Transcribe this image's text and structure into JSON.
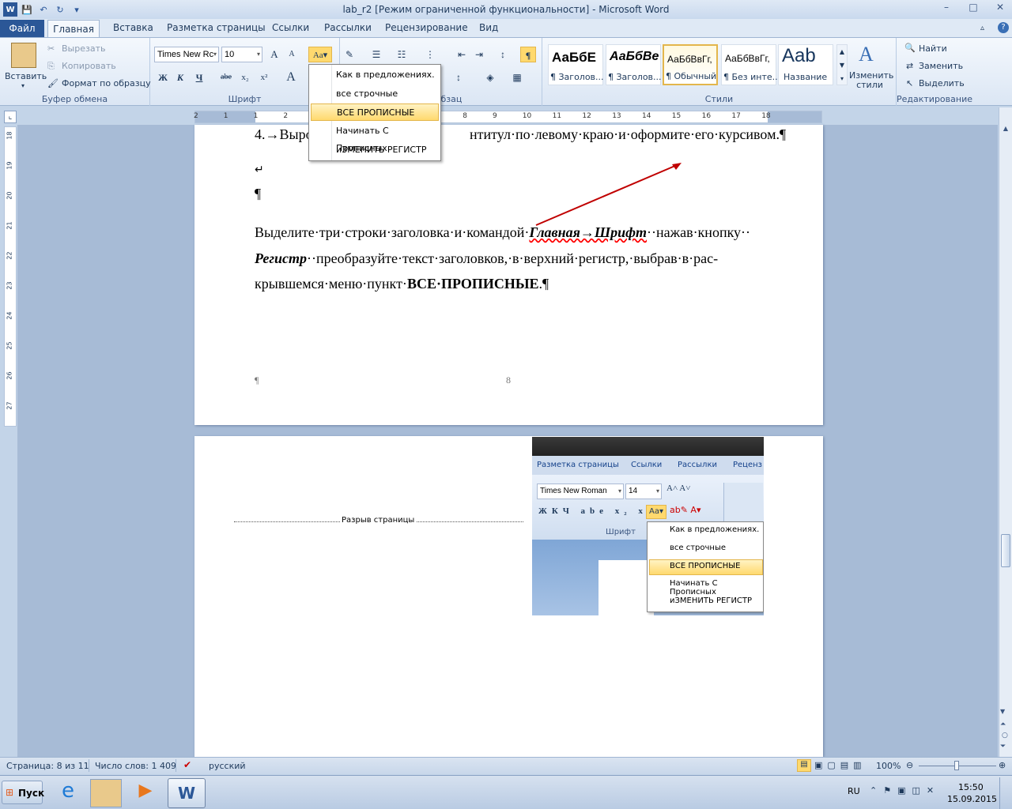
{
  "titlebar": {
    "title": "lab_r2 [Режим ограниченной функциональности]  -  Microsoft Word",
    "qat_icons": [
      "word-icon",
      "save-icon",
      "undo-icon",
      "redo-icon",
      "customize-icon"
    ],
    "min": "–",
    "max": "□",
    "close": "✕"
  },
  "tabs": {
    "file": "Файл",
    "home": "Главная",
    "items": [
      "Вставка",
      "Разметка страницы",
      "Ссылки",
      "Рассылки",
      "Рецензирование",
      "Вид"
    ]
  },
  "ribbon": {
    "clipboard": {
      "paste": "Вставить",
      "cut": "Вырезать",
      "copy": "Копировать",
      "format_painter": "Формат по образцу",
      "label": "Буфер обмена"
    },
    "font": {
      "name": "Times New Rc",
      "size": "10",
      "bold": "Ж",
      "italic": "К",
      "underline": "Ч",
      "strike": "abe",
      "sub": "x₂",
      "sup": "x²",
      "grow": "A",
      "shrink": "A",
      "case": "Aa",
      "label": "Шрифт"
    },
    "paragraph": {
      "label": "Абзац",
      "pilcrow": "¶"
    },
    "styles": {
      "label": "Стили",
      "items": [
        {
          "preview": "АаБбЕ",
          "name": "¶ Заголов..."
        },
        {
          "preview": "АаБбВе",
          "name": "¶ Заголов..."
        },
        {
          "preview": "АаБбВвГг,",
          "name": "¶ Обычный"
        },
        {
          "preview": "АаБбВвГг,",
          "name": "¶ Без инте..."
        },
        {
          "preview": "Aab",
          "name": "Название"
        }
      ],
      "change": "Изменить стили"
    },
    "editing": {
      "find": "Найти",
      "replace": "Заменить",
      "select": "Выделить",
      "label": "Редактирование"
    }
  },
  "case_menu": {
    "items": [
      "Как в предложениях.",
      "все строчные",
      "ВСЕ ПРОПИСНЫЕ",
      "Начинать С Прописных",
      "иЗМЕНИТЬ РЕГИСТР"
    ],
    "selected": 2
  },
  "ruler": {
    "h_ticks": [
      "2",
      "1",
      "1",
      "2",
      "3",
      "4",
      "5",
      "6",
      "7",
      "8",
      "9",
      "10",
      "11",
      "12",
      "13",
      "14",
      "15",
      "16",
      "17",
      "18"
    ],
    "v_ticks": [
      "18",
      "19",
      "20",
      "21",
      "22",
      "23",
      "24",
      "25",
      "26",
      "27"
    ]
  },
  "document": {
    "line1": "4.→Выро",
    "line1b": "нтитул·по·левому·краю·и·оформите·его·курсивом.¶",
    "linebreak": "↵",
    "pilcrow": "¶",
    "p1_a": "Выделите·три·строки·заголовка·и·командой·",
    "p1_b": "Главная→Шрифт",
    "p1_c": "··нажав·кнопку··",
    "p2_a": "Регистр",
    "p2_b": "··преобразуйте·текст·заголовков,·в·верхний·регистр,·выбрав·в·рас-",
    "p3_a": "крывшемся·меню·пункт·",
    "p3_b": "ВСЕ·ПРОПИСНЫЕ",
    "p3_c": ".¶",
    "footer_pilcrow": "¶",
    "page_number": "8",
    "page_break": "Разрыв страницы"
  },
  "inner_screenshot": {
    "tabs": [
      "Разметка страницы",
      "Ссылки",
      "Рассылки",
      "Реценз"
    ],
    "font": "Times New Roman",
    "size": "14",
    "group_label": "Шрифт",
    "menu": [
      "Как в предложениях.",
      "все строчные",
      "ВСЕ ПРОПИСНЫЕ",
      "Начинать С Прописных",
      "иЗМЕНИТЬ РЕГИСТР"
    ]
  },
  "status": {
    "page": "Страница: 8 из 11",
    "words": "Число слов: 1 409",
    "lang": "русский",
    "zoom": "100%"
  },
  "taskbar": {
    "start": "Пуск",
    "lang": "RU",
    "time": "15:50",
    "date": "15.09.2015"
  }
}
